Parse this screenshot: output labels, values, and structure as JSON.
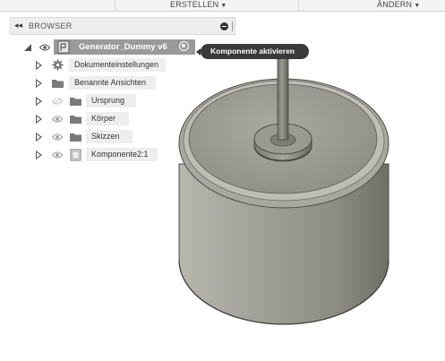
{
  "toolbar": {
    "create_label": "ERSTELLEN",
    "modify_label": "ÄNDERN"
  },
  "browser": {
    "title": "BROWSER",
    "root": {
      "label": "Generator_Dummy v6",
      "tooltip": "Komponente aktivieren"
    },
    "items": [
      {
        "label": "Dokumenteinstellungen",
        "icon": "gear-icon"
      },
      {
        "label": "Benannte Ansichten",
        "icon": "folder-icon"
      },
      {
        "label": "Ursprung",
        "icon": "folder-icon",
        "eye": "hidden"
      },
      {
        "label": "Körper",
        "icon": "folder-icon",
        "eye": "visible"
      },
      {
        "label": "Skizzen",
        "icon": "folder-icon",
        "eye": "visible"
      },
      {
        "label": "Komponente2:1",
        "icon": "component-icon",
        "eye": "visible"
      }
    ]
  },
  "colors": {
    "root_highlight": "#9a9a9a",
    "tooltip_bg": "#3a3a3a",
    "model_body": "#8a8a82"
  }
}
